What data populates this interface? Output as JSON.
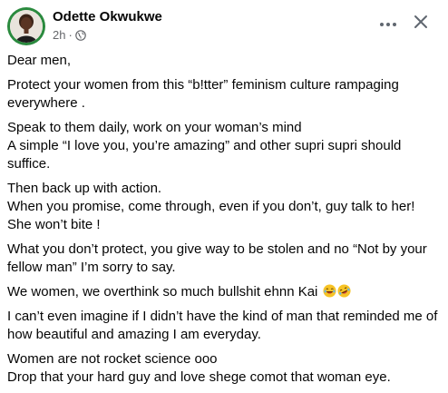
{
  "post": {
    "author": "Odette Okwukwe",
    "time": "2h",
    "dot": "·",
    "privacy_icon": "globe-icon",
    "more_icon": "more-dots-icon",
    "close_icon": "close-icon",
    "paragraphs": [
      "Dear men,",
      "Protect your women from this “b!tter” feminism culture rampaging everywhere .",
      "Speak to them daily, work on your woman’s mind\nA simple “I love you, you’re amazing” and other supri supri should suffice.",
      "Then back up with action.\nWhen you promise, come through, even if you don’t, guy talk to her!\nShe won’t bite !",
      "What you don’t protect, you give way to be stolen and no “Not by your fellow man” I’m sorry to say.",
      "We women, we overthink so much bullshit ehnn Kai",
      "I can’t even imagine if I didn’t have the kind of man that reminded me of how beautiful and amazing I am everyday.",
      "Women are not rocket science ooo\nDrop that your hard guy and love shege comot that woman eye."
    ],
    "paragraph6_emojis": [
      "laughing-emoji",
      "rolling-laughing-emoji"
    ]
  },
  "colors": {
    "avatar_ring": "#2a8a3e",
    "text": "#050505",
    "secondary_text": "#65676b",
    "icon": "#606770"
  }
}
